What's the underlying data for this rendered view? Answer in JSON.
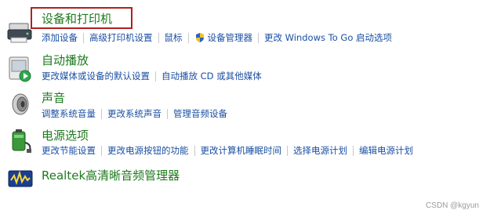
{
  "categories": [
    {
      "title": "设备和打印机",
      "icon": "printer-icon",
      "links": [
        "添加设备",
        "高级打印机设置",
        "鼠标",
        "设备管理器",
        "更改 Windows To Go 启动选项"
      ]
    },
    {
      "title": "自动播放",
      "icon": "autoplay-icon",
      "links": [
        "更改媒体或设备的默认设置",
        "自动播放 CD 或其他媒体"
      ]
    },
    {
      "title": "声音",
      "icon": "speaker-icon",
      "links": [
        "调整系统音量",
        "更改系统声音",
        "管理音频设备"
      ]
    },
    {
      "title": "电源选项",
      "icon": "battery-icon",
      "links": [
        "更改节能设置",
        "更改电源按钮的功能",
        "更改计算机睡眠时间",
        "选择电源计划",
        "编辑电源计划"
      ]
    },
    {
      "title": "Realtek高清晰音频管理器",
      "icon": "realtek-audio-icon",
      "links": []
    }
  ],
  "watermark": "CSDN @kgyun",
  "colors": {
    "title": "#1e7a1e",
    "link": "#1a4fa3",
    "highlight": "#b02020"
  }
}
